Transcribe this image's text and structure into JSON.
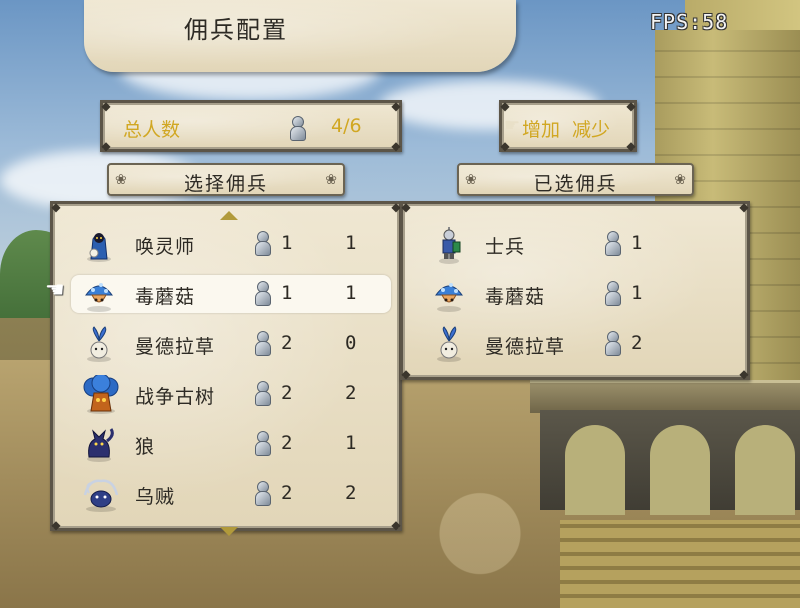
{
  "hud": {
    "fps": "FPS:58"
  },
  "title": "佣兵配置",
  "total": {
    "label": "总人数",
    "value": "4/6"
  },
  "controls": {
    "add_label": "增加",
    "remove_label": "减少"
  },
  "available_header": "选择佣兵",
  "selected_header": "已选佣兵",
  "available": [
    {
      "name": "唤灵师",
      "cost": "1",
      "count": "1",
      "icon": "necromancer-icon"
    },
    {
      "name": "毒蘑菇",
      "cost": "1",
      "count": "1",
      "icon": "poison-mushroom-icon"
    },
    {
      "name": "曼德拉草",
      "cost": "2",
      "count": "0",
      "icon": "mandrake-icon"
    },
    {
      "name": "战争古树",
      "cost": "2",
      "count": "2",
      "icon": "war-ancient-tree-icon"
    },
    {
      "name": "狼",
      "cost": "2",
      "count": "1",
      "icon": "wolf-icon"
    },
    {
      "name": "乌贼",
      "cost": "2",
      "count": "2",
      "icon": "squid-icon"
    }
  ],
  "selected": [
    {
      "name": "士兵",
      "cost": "1",
      "icon": "soldier-icon"
    },
    {
      "name": "毒蘑菇",
      "cost": "1",
      "icon": "poison-mushroom-icon"
    },
    {
      "name": "曼德拉草",
      "cost": "2",
      "icon": "mandrake-icon"
    }
  ],
  "selected_index": 1,
  "colors": {
    "accent_gold": "#d1a722",
    "text_dark": "#2d2a24",
    "parchment": "#e9e0c8"
  }
}
